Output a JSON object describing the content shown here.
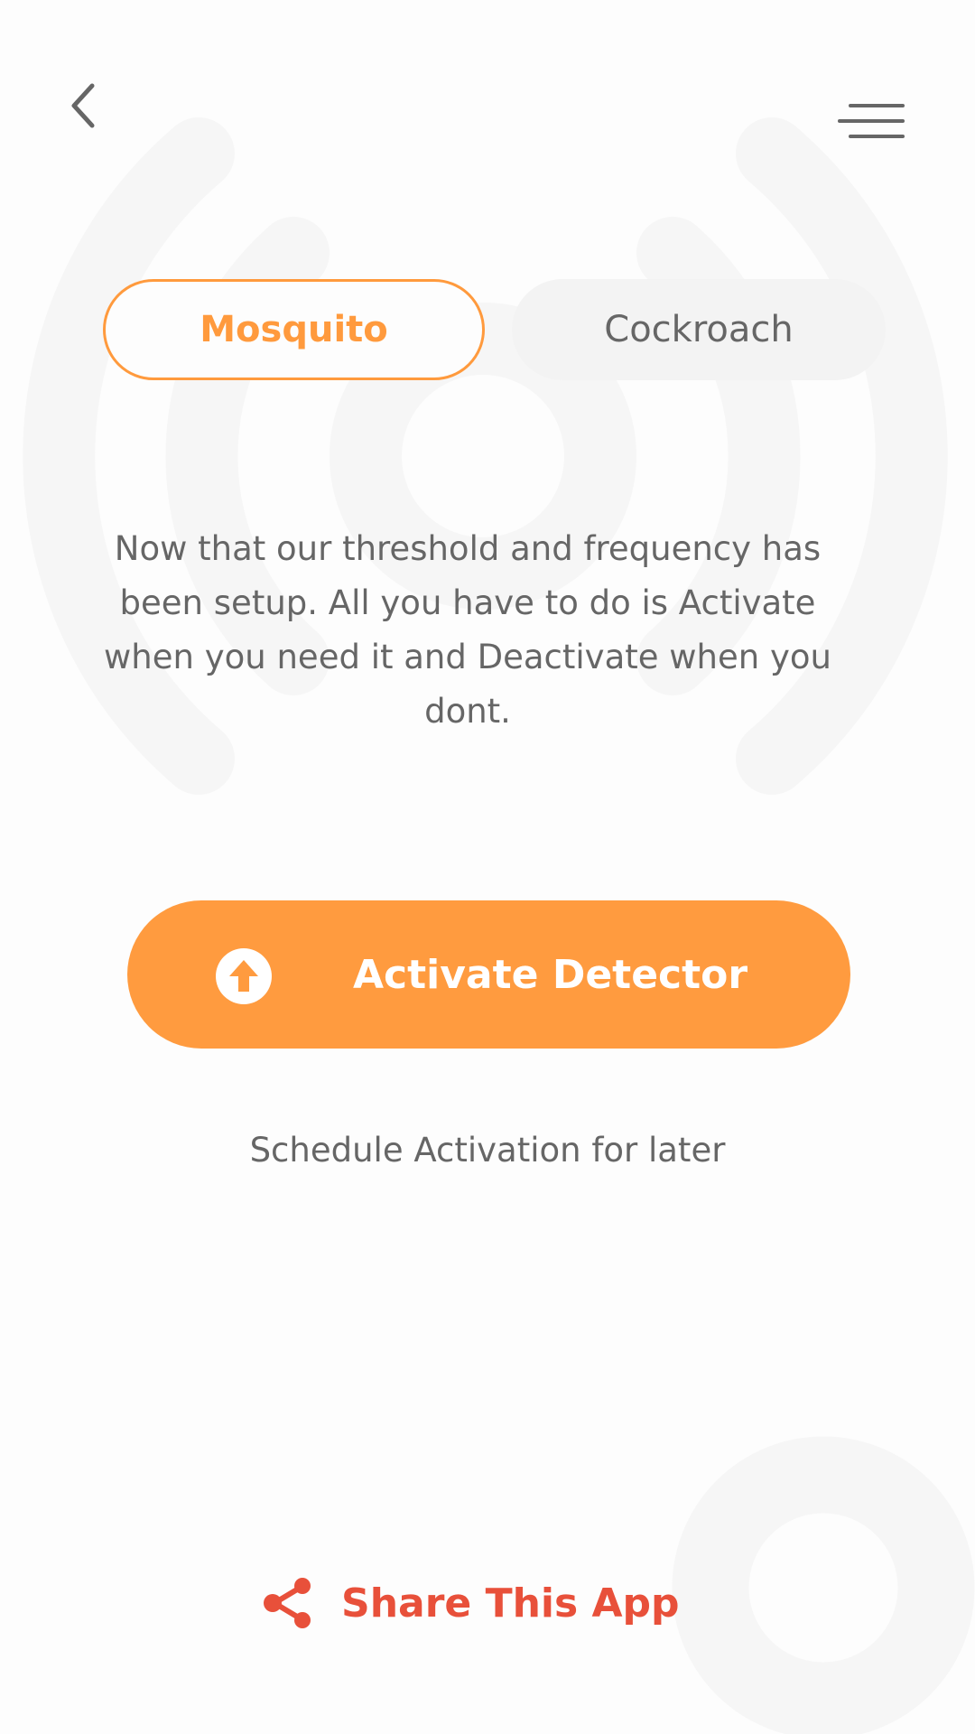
{
  "colors": {
    "accent": "#ff9b3f",
    "share": "#e8503a",
    "text_muted": "#666666"
  },
  "header": {
    "back_icon": "chevron-left-icon",
    "menu_icon": "hamburger-menu-icon"
  },
  "tabs": [
    {
      "label": "Mosquito",
      "active": true
    },
    {
      "label": "Cockroach",
      "active": false
    }
  ],
  "description": "Now that our threshold and frequency has been setup. All you have to do is Activate when you need it and Deactivate when you dont.",
  "activate_button": {
    "label": "Activate Detector",
    "icon": "arrow-up-circle-icon"
  },
  "schedule_link": "Schedule Activation for later",
  "share": {
    "label": "Share This App",
    "icon": "share-icon"
  }
}
